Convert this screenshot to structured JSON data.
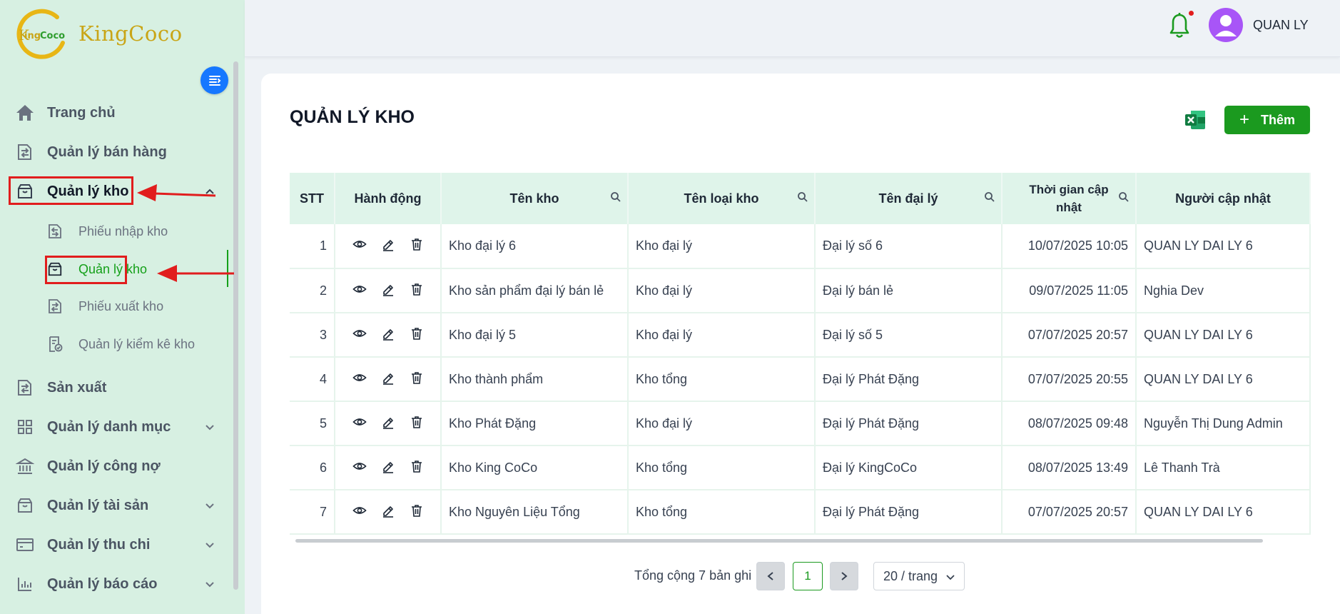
{
  "brand": {
    "name": "KingCoco",
    "logo_text": "KingCoco"
  },
  "header": {
    "user_name": "QUAN LY"
  },
  "sidebar": {
    "items": [
      {
        "label": "Trang chủ",
        "icon": "home-icon"
      },
      {
        "label": "Quản lý bán hàng",
        "icon": "sales-icon"
      },
      {
        "label": "Quản lý kho",
        "icon": "warehouse-icon",
        "expanded": true
      },
      {
        "label": "Sản xuất",
        "icon": "production-icon"
      },
      {
        "label": "Quản lý danh mục",
        "icon": "grid-icon",
        "has_children": true
      },
      {
        "label": "Quản lý công nợ",
        "icon": "bank-icon"
      },
      {
        "label": "Quản lý tài sản",
        "icon": "box-icon",
        "has_children": true
      },
      {
        "label": "Quản lý thu chi",
        "icon": "card-icon",
        "has_children": true
      },
      {
        "label": "Quản lý báo cáo",
        "icon": "chart-icon",
        "has_children": true
      }
    ],
    "subitems": [
      {
        "label": "Phiếu nhập kho",
        "icon": "import-icon"
      },
      {
        "label": "Quản lý kho",
        "icon": "warehouse-icon",
        "active": true
      },
      {
        "label": "Phiếu xuất kho",
        "icon": "export-icon"
      },
      {
        "label": "Quản lý kiểm kê kho",
        "icon": "inventory-check-icon"
      }
    ]
  },
  "main": {
    "title": "QUẢN LÝ KHO",
    "add_label": "Thêm",
    "table": {
      "columns": [
        "STT",
        "Hành động",
        "Tên kho",
        "Tên loại kho",
        "Tên đại lý",
        "Thời gian cập nhật",
        "Người cập nhật"
      ],
      "rows": [
        [
          "1",
          "Kho đại lý 6",
          "Kho đại lý",
          "Đại lý số 6",
          "10/07/2025 10:05",
          "QUAN LY DAI LY 6"
        ],
        [
          "2",
          "Kho sản phẩm đại lý bán lẻ",
          "Kho đại lý",
          "Đại lý bán lẻ",
          "09/07/2025 11:05",
          "Nghia Dev"
        ],
        [
          "3",
          "Kho đại lý 5",
          "Kho đại lý",
          "Đại lý số 5",
          "07/07/2025 20:57",
          "QUAN LY DAI LY 6"
        ],
        [
          "4",
          "Kho thành phẩm",
          "Kho tổng",
          "Đại lý Phát Đặng",
          "07/07/2025 20:55",
          "QUAN LY DAI LY 6"
        ],
        [
          "5",
          "Kho Phát Đặng",
          "Kho đại lý",
          "Đại lý Phát Đặng",
          "08/07/2025 09:48",
          "Nguyễn Thị Dung Admin"
        ],
        [
          "6",
          "Kho King CoCo",
          "Kho tổng",
          "Đại lý KingCoCo",
          "08/07/2025 13:49",
          "Lê Thanh Trà"
        ],
        [
          "7",
          "Kho Nguyên Liệu Tổng",
          "Kho tổng",
          "Đại lý Phát Đặng",
          "07/07/2025 20:57",
          "QUAN LY DAI LY 6"
        ]
      ]
    },
    "pagination": {
      "total_text": "Tổng cộng 7 bản ghi",
      "current_page": "1",
      "page_size": "20 / trang"
    }
  },
  "colors": {
    "accent": "#1b9a1f",
    "sidebar_bg": "#d7f0e2",
    "highlight": "#e11d1d"
  }
}
